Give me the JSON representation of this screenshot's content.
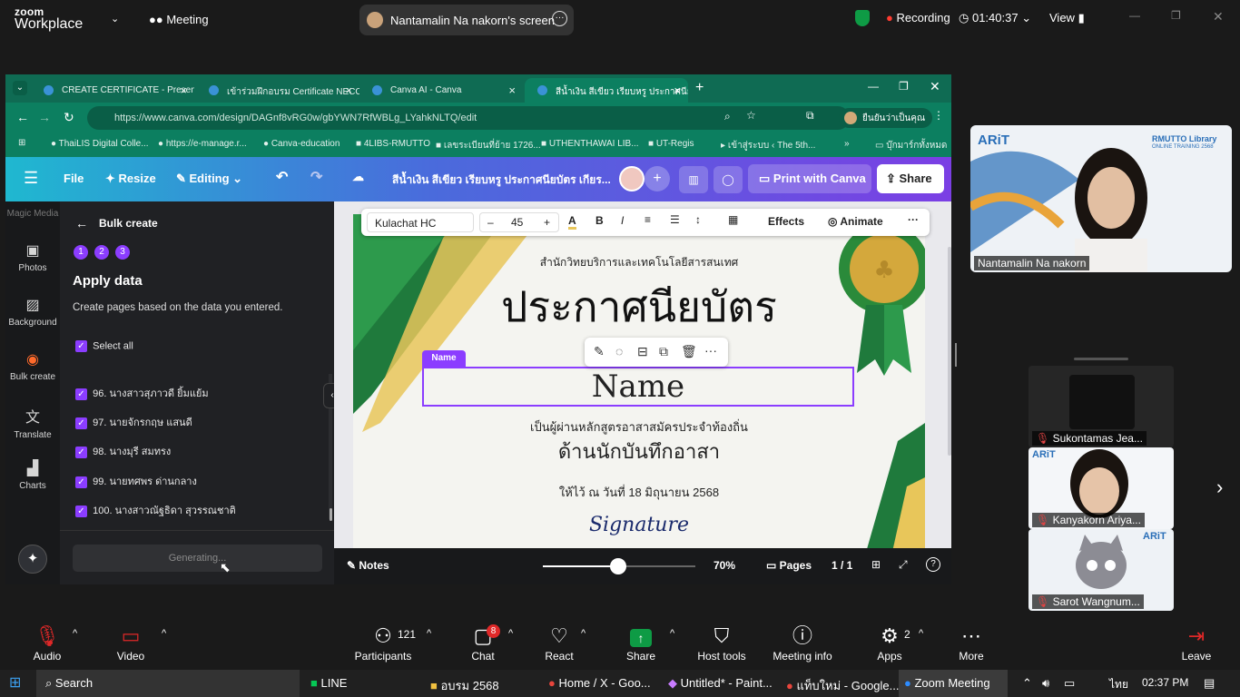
{
  "zoom": {
    "brand1": "zoom",
    "brand2": "Workplace",
    "meeting": "Meeting",
    "screen_owner": "Nantamalin Na nakorn's screen",
    "recording": "Recording",
    "timer": "01:40:37",
    "view": "View"
  },
  "browser": {
    "tabs": [
      {
        "label": "CREATE CERTIFICATE - Presenta"
      },
      {
        "label": "เข้าร่วมฝึกอบรม Certificate NECC"
      },
      {
        "label": "Canva AI - Canva"
      },
      {
        "label": "สีน้ำเงิน สีเขียว เรียบหรู ประกาศนียบัตร"
      }
    ],
    "url": "https://www.canva.com/design/DAGnf8vRG0w/gbYWN7RfWBLg_LYahkNLTQ/edit",
    "profile": "ยืนยันว่าเป็นคุณ",
    "bookmarks": [
      "ThaiLIS Digital Colle...",
      "https://e-manage.r...",
      "Canva-education",
      "4LIBS-RMUTTO",
      "เลขระเบียนที่ย้าย 1726...",
      "UTHENTHAWAI LIB...",
      "UT-Regis",
      "เข้าสู่ระบบ ‹ The 5th..."
    ],
    "bookmark_folder": "บุ๊กมาร์กทั้งหมด"
  },
  "canva": {
    "file": "File",
    "resize": "Resize",
    "editing": "Editing",
    "doc_title": "สีน้ำเงิน สีเขียว เรียบหรู ประกาศนียบัตร เกียร...",
    "print": "Print with Canva",
    "share": "Share",
    "rail": [
      {
        "label": "Magic Media"
      },
      {
        "label": "Photos"
      },
      {
        "label": "Background"
      },
      {
        "label": "Bulk create"
      },
      {
        "label": "Translate"
      },
      {
        "label": "Charts"
      }
    ],
    "panel": {
      "title": "Bulk create",
      "steps": [
        "1",
        "2",
        "3"
      ],
      "heading": "Apply data",
      "desc": "Create pages based on the data you entered.",
      "select_all": "Select all",
      "rows": [
        "96. นางสาวสุภาวดี ยิ้มแย้ม",
        "97. นายจักรกฤษ แสนดี",
        "98. นางมุรี สมทรง",
        "99. นายทศพร ด่านกลาง",
        "100. นางสาวณัฐธิดา สุวรรณชาติ"
      ],
      "button": "Generating..."
    },
    "toolbar": {
      "font": "Kulachat HC",
      "size": "45",
      "minus": "–",
      "plus": "+",
      "effects": "Effects",
      "animate": "Animate"
    },
    "certificate": {
      "org": "สำนักวิทยบริการและเทคโนโลยีสารสนเทศ",
      "title": "ประกาศนียบัตร",
      "name_tag": "Name",
      "name": "Name",
      "line1": "เป็นผู้ผ่านหลักสูตรอาสาสมัครประจำท้องถิ่น",
      "line2": "ด้านนักบันทึกอาสา",
      "date": "ให้ไว้ ณ วันที่ 18 มิถุนายน 2568",
      "signature": "Signature"
    },
    "bottom": {
      "notes": "Notes",
      "zoom": "70%",
      "pages": "Pages",
      "page_count": "1 / 1"
    }
  },
  "videos": {
    "self": "Nantamalin Na nakorn",
    "brand": "RMUTTO Library",
    "brand_sub": "ONLINE TRAINING 2568",
    "p1": "Sukontamas Jea...",
    "p2": "Kanyakorn Ariya...",
    "p3": "Sarot Wangnum..."
  },
  "zoom_bottom": {
    "audio": "Audio",
    "video": "Video",
    "participants": "Participants",
    "participants_count": "121",
    "chat": "Chat",
    "chat_badge": "8",
    "react": "React",
    "share": "Share",
    "host": "Host tools",
    "info": "Meeting info",
    "apps": "Apps",
    "apps_count": "2",
    "more": "More",
    "leave": "Leave"
  },
  "taskbar": {
    "search": "Search",
    "items": [
      "LINE",
      "อบรม 2568",
      "Home / X - Goo...",
      "Untitled* - Paint...",
      "แท็บใหม่ - Google...",
      "Zoom Meeting"
    ],
    "lang": "ไทย",
    "time": "02:37 PM"
  },
  "colors": {
    "canva_purple": "#8b3dff",
    "zoom_green": "#0e9b45",
    "recording": "#ff3b30",
    "leave": "#e02828"
  }
}
